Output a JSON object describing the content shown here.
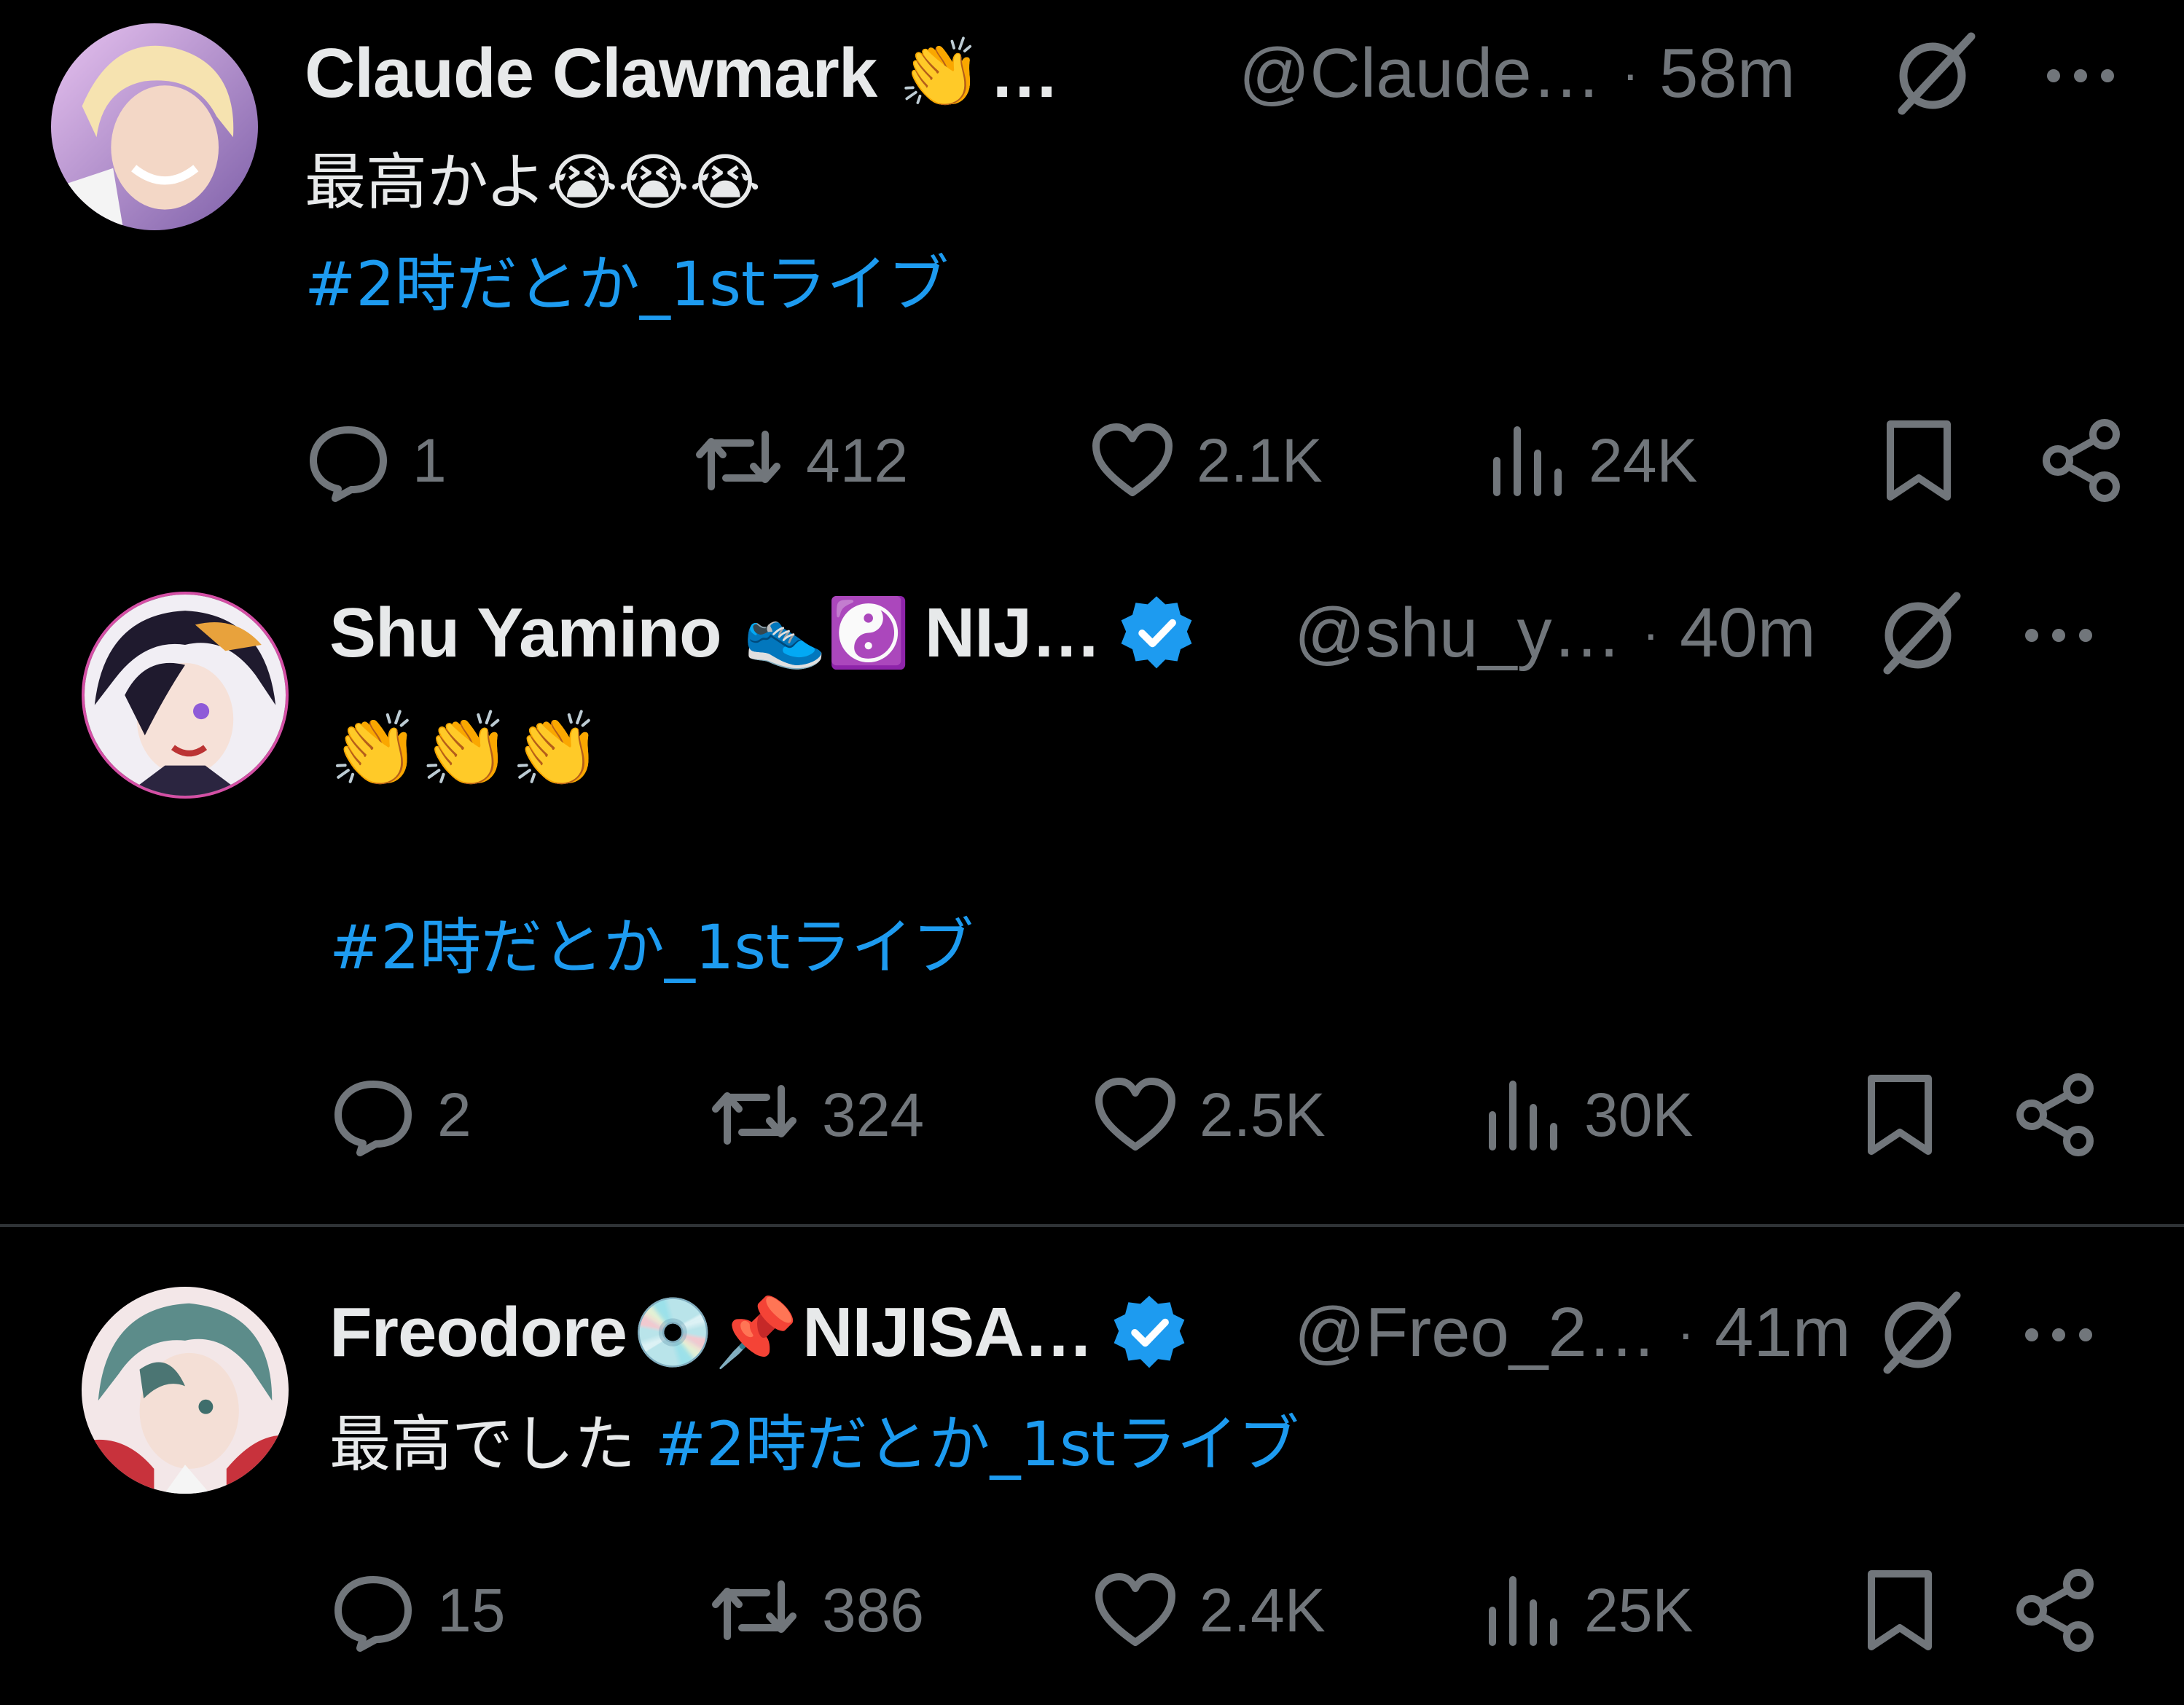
{
  "colors": {
    "background": "#000000",
    "text": "#e7e9ea",
    "muted": "#71767b",
    "link": "#1d9bf0",
    "divider": "#2f3336",
    "verified": "#1d9bf0"
  },
  "tweets": [
    {
      "author": {
        "name": "Claude Clawmark",
        "name_suffix_emoji": "👏",
        "name_ellipsis": "…",
        "verified": false,
        "handle": "@Claude…",
        "avatar_icon": "avatar-blonde-character"
      },
      "separator": "·",
      "time": "58m",
      "text": "最高かよ😭😭😭",
      "hashtag": "#2時だとか_1stライブ",
      "actions": {
        "replies": "1",
        "reposts": "412",
        "likes": "2.1K",
        "views": "24K"
      }
    },
    {
      "author": {
        "name": "Shu Yamino",
        "name_suffix_emoji": "👟☯️",
        "name_tail": "NIJ…",
        "verified": true,
        "handle": "@shu_y…",
        "avatar_icon": "avatar-dark-hair-character"
      },
      "separator": "·",
      "time": "40m",
      "text": "👏👏👏",
      "hashtag": "#2時だとか_1stライブ",
      "actions": {
        "replies": "2",
        "reposts": "324",
        "likes": "2.5K",
        "views": "30K"
      }
    },
    {
      "author": {
        "name": "Freodore",
        "name_suffix_emoji": "💿📌",
        "name_tail": "NIJISA…",
        "verified": true,
        "handle": "@Freo_2…",
        "avatar_icon": "avatar-teal-hair-character"
      },
      "separator": "·",
      "time": "41m",
      "text": "最高でした",
      "hashtag": "#2時だとか_1stライブ",
      "actions": {
        "replies": "15",
        "reposts": "386",
        "likes": "2.4K",
        "views": "25K"
      }
    }
  ]
}
